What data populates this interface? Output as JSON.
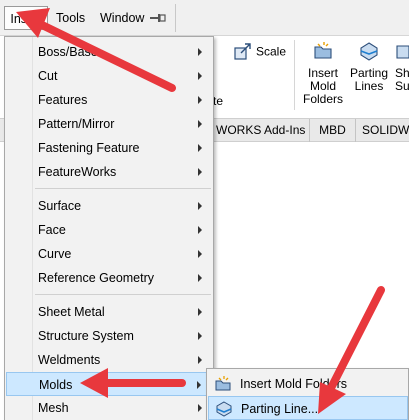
{
  "menubar": {
    "insert": "Insert",
    "tools": "Tools",
    "window": "Window",
    "pin_icon": "pin-icon"
  },
  "ribbon": {
    "scale": "Scale",
    "insert_mold_folders": [
      "Insert",
      "Mold",
      "Folders"
    ],
    "parting_lines": [
      "Parting",
      "Lines"
    ],
    "partial": [
      "Sh",
      "Su"
    ],
    "partial_text": "te"
  },
  "tabs": {
    "addins": "WORKS Add-Ins",
    "mbd": "MBD",
    "solidw": "SOLIDW"
  },
  "menu": {
    "items": [
      {
        "label": "Boss/Base",
        "submenu": true
      },
      {
        "label": "Cut",
        "submenu": true
      },
      {
        "label": "Features",
        "submenu": true
      },
      {
        "label": "Pattern/Mirror",
        "submenu": true
      },
      {
        "label": "Fastening Feature",
        "submenu": true
      },
      {
        "label": "FeatureWorks",
        "submenu": true
      },
      {
        "label": "Surface",
        "submenu": true
      },
      {
        "label": "Face",
        "submenu": true
      },
      {
        "label": "Curve",
        "submenu": true
      },
      {
        "label": "Reference Geometry",
        "submenu": true
      },
      {
        "label": "Sheet Metal",
        "submenu": true
      },
      {
        "label": "Structure System",
        "submenu": true
      },
      {
        "label": "Weldments",
        "submenu": true
      },
      {
        "label": "Molds",
        "submenu": true,
        "highlighted": true
      },
      {
        "label": "Mesh",
        "submenu": true
      }
    ]
  },
  "submenu": {
    "items": [
      {
        "label": "Insert Mold Folders",
        "icon": "mold-folder-icon"
      },
      {
        "label": "Parting Line...",
        "icon": "parting-line-icon",
        "highlighted": true
      }
    ]
  },
  "colors": {
    "highlight": "#cde8ff",
    "highlight_border": "#98c7f0",
    "annotation_arrow": "#e8383d",
    "menu_bg": "#f2f2f2"
  }
}
